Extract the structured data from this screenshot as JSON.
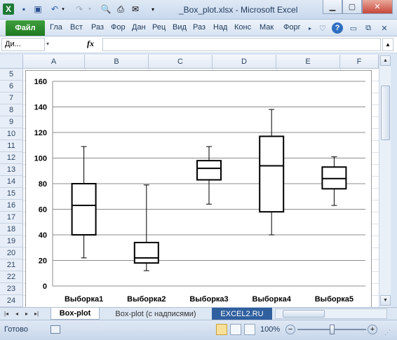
{
  "window": {
    "title": "_Box_plot.xlsx  -  Microsoft Excel",
    "minimize_icon": "minimize-icon",
    "maximize_icon": "maximize-icon",
    "close_icon": "close-icon"
  },
  "quick_access": {
    "icons": [
      "excel-logo-icon",
      "save-icon",
      "save-as-icon",
      "undo-icon",
      "redo-icon",
      "print-preview-icon",
      "print-icon",
      "email-icon",
      "customize-dropdown-icon"
    ]
  },
  "ribbon": {
    "file_label": "Файл",
    "tabs": [
      "Гла",
      "Вст",
      "Раз",
      "Фор",
      "Дан",
      "Рец",
      "Вид",
      "Раз",
      "Над",
      "Конс",
      "Мак",
      "Форг"
    ],
    "right_icons": [
      "more-tabs-icon",
      "minimize-ribbon-icon",
      "help-icon",
      "window-minimize-icon",
      "window-restore-icon",
      "window-close-icon"
    ]
  },
  "formula_bar": {
    "name_box": "Ди...",
    "fx_label": "fx",
    "formula": ""
  },
  "sheet": {
    "columns": [
      "A",
      "B",
      "C",
      "D",
      "E",
      "F"
    ],
    "rows": [
      "5",
      "6",
      "7",
      "8",
      "9",
      "10",
      "11",
      "12",
      "13",
      "14",
      "15",
      "16",
      "17",
      "18",
      "19",
      "20",
      "21",
      "22",
      "23",
      "24"
    ]
  },
  "chart_data": {
    "type": "boxplot",
    "categories": [
      "Выборка1",
      "Выборка2",
      "Выборка3",
      "Выборка4",
      "Выборка5"
    ],
    "boxes": [
      {
        "min": 22,
        "q1": 40,
        "median": 63,
        "q3": 80,
        "max": 109
      },
      {
        "min": 12,
        "q1": 18,
        "median": 22,
        "q3": 34,
        "max": 79
      },
      {
        "min": 64,
        "q1": 83,
        "median": 92,
        "q3": 98,
        "max": 109
      },
      {
        "min": 40,
        "q1": 58,
        "median": 94,
        "q3": 117,
        "max": 138
      },
      {
        "min": 63,
        "q1": 76,
        "median": 84,
        "q3": 93,
        "max": 101
      }
    ],
    "yticks": [
      "0",
      "20",
      "40",
      "60",
      "80",
      "100",
      "120",
      "140",
      "160"
    ],
    "ylim": [
      0,
      160
    ],
    "grid": true,
    "legend": "none",
    "line_color": "#000000"
  },
  "sheet_tabs": {
    "nav_icons": [
      "first-sheet-icon",
      "prev-sheet-icon",
      "next-sheet-icon",
      "last-sheet-icon"
    ],
    "tabs": [
      "Box-plot",
      "Box-plot (с надписями)",
      "EXCEL2.RU"
    ],
    "active_color": "#2f5f9e"
  },
  "status": {
    "ready": "Готово",
    "zoom": "100%",
    "zoom_out": "−",
    "zoom_in": "+",
    "zoom_fraction": 0.5
  }
}
